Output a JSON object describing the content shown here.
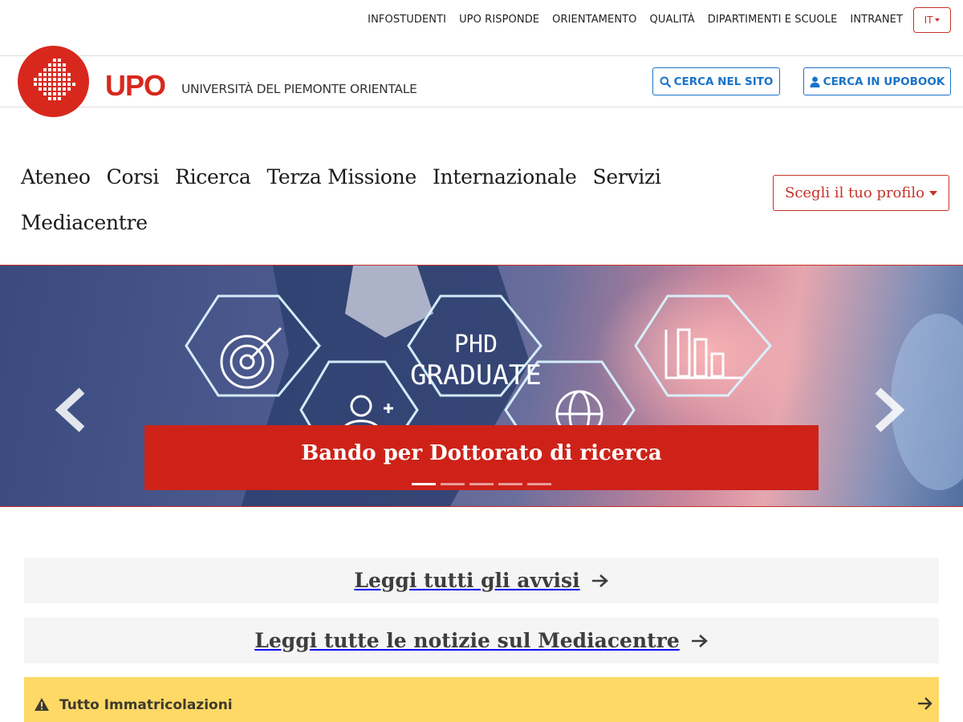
{
  "topbar": {
    "links": [
      "INFOSTUDENTI",
      "UPO RISPONDE",
      "ORIENTAMENTO",
      "QUALITÀ",
      "DIPARTIMENTI E SCUOLE",
      "INTRANET"
    ],
    "language": "IT"
  },
  "brand": {
    "acronym": "UPO",
    "full_name": "UNIVERSITÀ DEL PIEMONTE ORIENTALE",
    "color": "#d8281d"
  },
  "search": {
    "site_label": "CERCA NEL SITO",
    "upobook_label": "CERCA IN UPOBOOK",
    "accent": "#1a73c8"
  },
  "nav": {
    "row1": [
      "Ateneo",
      "Corsi",
      "Ricerca",
      "Terza Missione",
      "Internazionale",
      "Servizi"
    ],
    "row2": [
      "Mediacentre"
    ],
    "profile_label": "Scegli il tuo profilo"
  },
  "hero": {
    "caption": "Bando per Dottorato di ricerca",
    "image_text": [
      "PHD",
      "GRADUATE"
    ],
    "slide_count": 5,
    "active_slide": 1,
    "prev_icon": "chevron-left-icon",
    "next_icon": "chevron-right-icon"
  },
  "links": {
    "avvisi": "Leggi tutti gli avvisi",
    "notizie": "Leggi tutte le notizie sul Mediacentre"
  },
  "alert": {
    "label": "Tutto Immatricolazioni",
    "icon": "warning-icon",
    "color": "#ffd966"
  }
}
